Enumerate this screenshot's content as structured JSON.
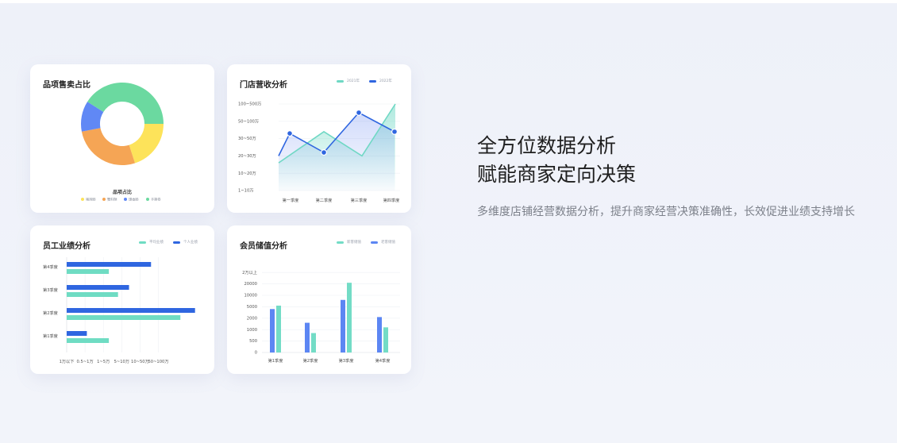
{
  "cards": {
    "product": {
      "title": "品项售卖占比",
      "center_label": "品项占比",
      "legend": [
        "猪蹄肠",
        "蟹籽酥",
        "馒香肠",
        "手撕卷"
      ],
      "chart_data": {
        "type": "pie",
        "categories": [
          "猪蹄肠",
          "蟹籽酥",
          "馒香肠",
          "手撕卷"
        ],
        "values": [
          20,
          27,
          12,
          41
        ],
        "colors": [
          "#fde35a",
          "#f5a555",
          "#6088f5",
          "#6bd9a0"
        ]
      }
    },
    "store": {
      "title": "门店营收分析",
      "legend": [
        "2021年",
        "2022年"
      ],
      "chart_data": {
        "type": "line",
        "categories": [
          "第一季度",
          "第二季度",
          "第三季度",
          "第四季度"
        ],
        "y_levels": [
          "1~10万",
          "10~20万",
          "20~30万",
          "30~50万",
          "50~100万",
          "100~500万"
        ],
        "series": [
          {
            "name": "2021年",
            "color": "#6fd8c4",
            "values": [
              1.6,
              3.4,
              2.0,
              5.0
            ],
            "end_value": 5.0
          },
          {
            "name": "2022年",
            "color": "#2f66e0",
            "values": [
              2.0,
              3.3,
              2.2,
              4.5,
              3.4
            ]
          }
        ]
      }
    },
    "staff": {
      "title": "员工业绩分析",
      "legend": [
        "平均业绩",
        "个人业绩"
      ],
      "chart_data": {
        "type": "bar",
        "orientation": "horizontal",
        "categories": [
          "第4季度",
          "第3季度",
          "第2季度",
          "第1季度"
        ],
        "x_levels": [
          "1万以下",
          "0.5~1万",
          "1~5万",
          "5~10万",
          "10~50万",
          "50~100万"
        ],
        "series": [
          {
            "name": "个人业绩",
            "color": "#2f66e0",
            "values": [
              2.3,
              1.7,
              3.5,
              0.55
            ]
          },
          {
            "name": "平均业绩",
            "color": "#6fdcc3",
            "values": [
              1.15,
              1.4,
              3.1,
              1.15
            ]
          }
        ]
      }
    },
    "member": {
      "title": "会员储值分析",
      "legend": [
        "新客储值",
        "老客储值"
      ],
      "chart_data": {
        "type": "bar",
        "categories": [
          "第1季度",
          "第2季度",
          "第3季度",
          "第4季度"
        ],
        "y_levels": [
          "0",
          "500",
          "1000",
          "2000",
          "5000",
          "10000",
          "20000",
          "2万以上"
        ],
        "series": [
          {
            "name": "老客储值",
            "color": "#5c86f3",
            "values": [
              3.8,
              2.6,
              4.6,
              3.1
            ]
          },
          {
            "name": "新客储值",
            "color": "#73dcc6",
            "values": [
              4.1,
              1.7,
              6.1,
              2.2
            ]
          }
        ]
      }
    }
  },
  "headline": {
    "line1": "全方位数据分析",
    "line2": "赋能商家定向决策"
  },
  "description": "多维度店铺经营数据分析，提升商家经营决策准确性，长效促进业绩支持增长"
}
